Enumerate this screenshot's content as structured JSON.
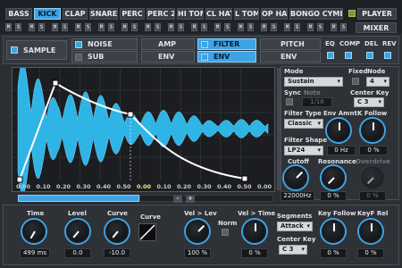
{
  "tabs": [
    "BASS",
    "KICK",
    "CLAP",
    "SNARE",
    "PERC",
    "PERC 2",
    "HI TOM",
    "CL HAT",
    "L TOM",
    "OP HAT",
    "BONGO CYMBAL"
  ],
  "player_tab": "PLAYER",
  "mixer_tab": "MIXER",
  "ms_letters": {
    "m": "M",
    "s": "S"
  },
  "sections": {
    "sample": "SAMPLE",
    "noise": "NOISE",
    "sub": "SUB",
    "amp": "AMP",
    "amp_env": "ENV",
    "filter": "FILTER",
    "filter_env": "ENV",
    "pitch": "PITCH",
    "pitch_env": "ENV",
    "eq": "EQ",
    "comp": "COMP",
    "del": "DEL",
    "rev": "REV"
  },
  "graph": {
    "x_ticks": [
      "0.00",
      "0.10",
      "0.20",
      "0.30",
      "0.40",
      "0.50",
      "0.00",
      "0.10",
      "0.20",
      "0.30",
      "0.40",
      "0.50",
      "0.00"
    ],
    "minus": "-",
    "plus": "+"
  },
  "right": {
    "mode_label": "Mode",
    "mode_value": "Sustain",
    "fixed_label": "Fixed",
    "node_label": "Node",
    "node_value": "4",
    "sync_label": "Sync",
    "note_label": "Note",
    "rate_label": "1/16",
    "center_key_label": "Center Key",
    "center_key_value": "C 3",
    "filter_type_label": "Filter Type",
    "filter_type_value": "Classic",
    "env_amnt_label": "Env Amnt",
    "k_follow_label": "K Follow",
    "filter_shape_label": "Filter Shape",
    "filter_shape_value": "LP24",
    "env_amnt_value": "0 Hz",
    "k_follow_value": "0 %",
    "cutoff_label": "Cutoff",
    "resonance_label": "Resonance",
    "overdrive_label": "Overdrive",
    "cutoff_value": "22000Hz",
    "resonance_value": "0 %",
    "overdrive_value": "0 %"
  },
  "bottom": {
    "time_label": "Time",
    "time_value": "499 ms",
    "level_label": "Level",
    "level_value": "0.0",
    "curve_label": "Curve",
    "curve_value": "-10.0",
    "curve2_label": "Curve",
    "vel_lev_label": "Vel > Lev",
    "vel_lev_value": "100 %",
    "norm_label": "Norm",
    "vel_time_label": "Vel > Time",
    "vel_time_value": "0 %",
    "segments_label": "Segments",
    "segments_value": "Attack",
    "center_key_label": "Center Key",
    "center_key_value": "C 3",
    "key_follow_label": "Key Follow",
    "key_follow_value": "0 %",
    "keyf_rel_label": "KeyF Rel",
    "keyf_rel_value": "0 %"
  },
  "colors": {
    "accent": "#3da4e6",
    "wave": "#2fb4e6",
    "bg": "#2b2e33"
  }
}
